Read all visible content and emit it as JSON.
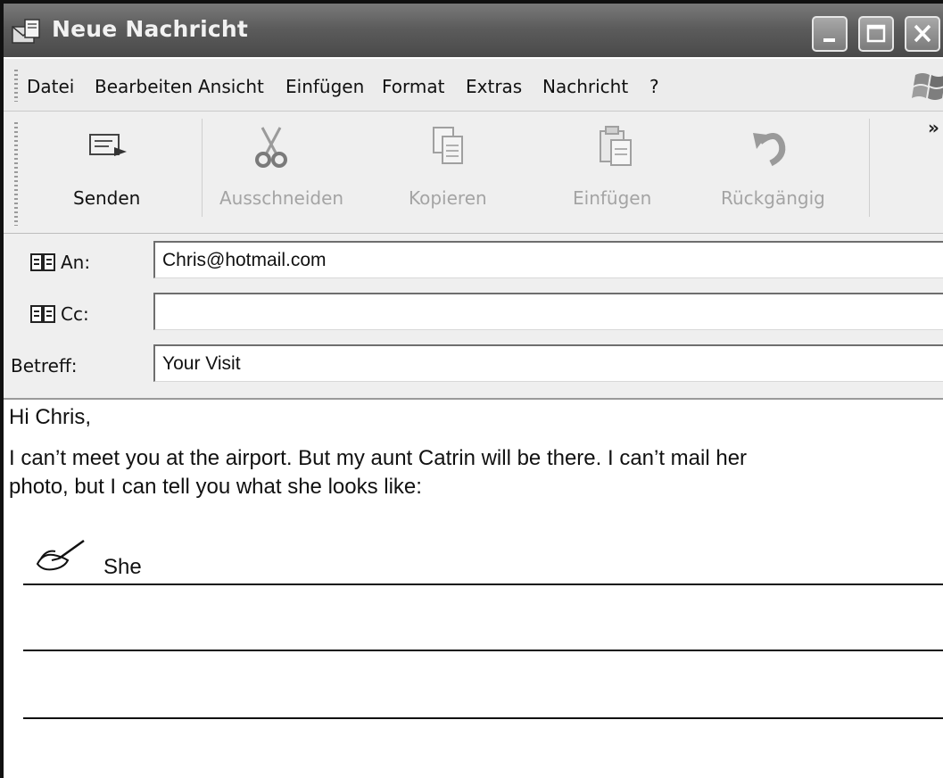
{
  "window": {
    "title": "Neue Nachricht",
    "controls": [
      "minimize-icon",
      "maximize-icon",
      "close-icon"
    ]
  },
  "menu": {
    "items": [
      "Datei",
      "Bearbeiten",
      "Ansicht",
      "Einfügen",
      "Format",
      "Extras",
      "Nachricht",
      "?"
    ]
  },
  "toolbar": {
    "buttons": [
      {
        "label": "Senden",
        "icon": "send-icon",
        "enabled": true
      },
      {
        "label": "Ausschneiden",
        "icon": "scissors-icon",
        "enabled": false
      },
      {
        "label": "Kopieren",
        "icon": "copy-icon",
        "enabled": false
      },
      {
        "label": "Einfügen",
        "icon": "paste-icon",
        "enabled": false
      },
      {
        "label": "Rückgängig",
        "icon": "undo-icon",
        "enabled": false
      }
    ],
    "overflow": "»"
  },
  "fields": {
    "to_label": "An:",
    "to_value": "Chris@hotmail.com",
    "cc_label": "Cc:",
    "cc_value": "",
    "subject_label": "Betreff:",
    "subject_value": "Your Visit"
  },
  "message": {
    "greeting": "Hi Chris,",
    "paragraph_line1": "I can’t meet you at the airport. But my aunt Catrin will be there. I can’t mail her",
    "paragraph_line2": "photo, but I can tell you what she looks like:",
    "starter": "She"
  },
  "colors": {
    "titlebar": "#5c5c5c",
    "chrome": "#efefef",
    "disabled_text": "#a4a4a4"
  }
}
